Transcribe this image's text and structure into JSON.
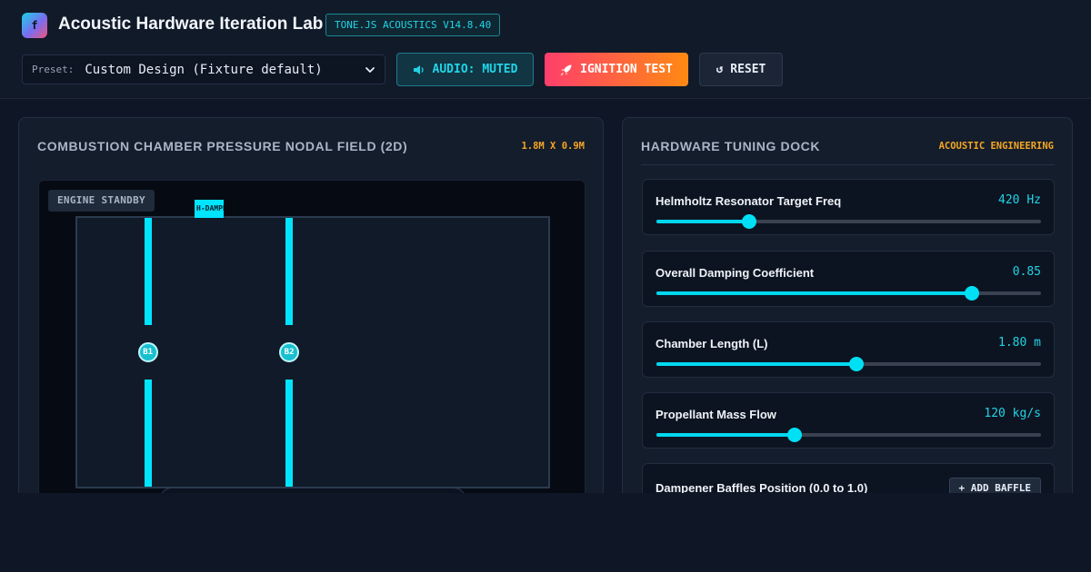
{
  "header": {
    "logo_glyph": "f",
    "title": "Acoustic Hardware Iteration Lab",
    "version": "TONE.JS ACOUSTICS V14.8.40"
  },
  "preset": {
    "label": "Preset:",
    "value": "Custom Design (Fixture default)"
  },
  "buttons": {
    "audio": "AUDIO: MUTED",
    "ignition": "IGNITION TEST",
    "reset": "↺ RESET"
  },
  "field_panel": {
    "title": "COMBUSTION CHAMBER PRESSURE NODAL FIELD (2D)",
    "dimensions": "1.8M X 0.9M",
    "status": "ENGINE STANDBY",
    "helmholtz_damper_label": "H-DAMPER",
    "baffles": [
      {
        "label": "B1",
        "position": 0.15
      },
      {
        "label": "B2",
        "position": 0.45
      }
    ],
    "helmholtz_damper_position": 0.28
  },
  "tuning_dock": {
    "title": "HARDWARE TUNING DOCK",
    "tag": "ACOUSTIC ENGINEERING",
    "controls": [
      {
        "label": "Helmholtz Resonator Target Freq",
        "value": "420 Hz",
        "fraction": 0.24
      },
      {
        "label": "Overall Damping Coefficient",
        "value": "0.85",
        "fraction": 0.82
      },
      {
        "label": "Chamber Length (L)",
        "value": "1.80 m",
        "fraction": 0.52
      },
      {
        "label": "Propellant Mass Flow",
        "value": "120 kg/s",
        "fraction": 0.36
      }
    ],
    "baffle_section": {
      "label": "Dampener Baffles Position (0.0 to 1.0)",
      "add_button": "+ ADD BAFFLE"
    }
  },
  "colors": {
    "accent": "#00e5ff",
    "warning": "#f5a623",
    "ignition_start": "#ff3f6c",
    "ignition_end": "#ff8a12"
  },
  "icons": {
    "audio": "speaker-icon",
    "ignition": "rocket-icon",
    "preset_dropdown": "chevron-down-icon"
  }
}
